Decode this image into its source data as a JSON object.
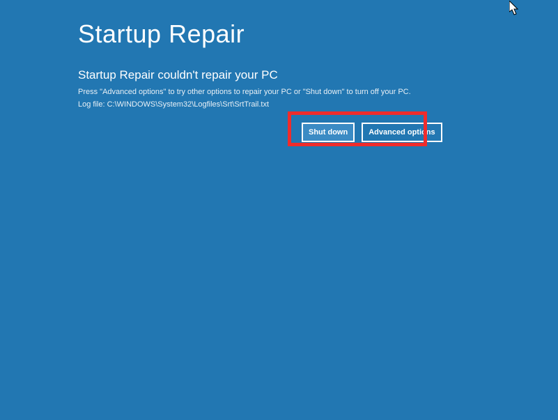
{
  "header": {
    "title": "Startup Repair"
  },
  "message": {
    "heading": "Startup Repair couldn't repair your PC",
    "instruction": "Press \"Advanced options\" to try other options to repair your PC or \"Shut down\" to turn off your PC.",
    "log_file": "Log file: C:\\WINDOWS\\System32\\Logfiles\\Srt\\SrtTrail.txt"
  },
  "buttons": {
    "shutdown_label": "Shut down",
    "advanced_label": "Advanced options"
  }
}
